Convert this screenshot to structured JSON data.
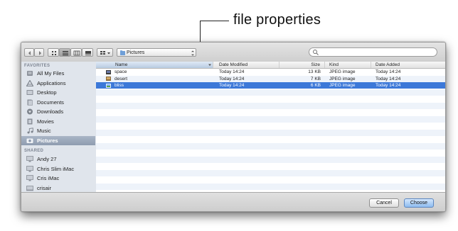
{
  "annotation": {
    "label": "file properties"
  },
  "toolbar": {
    "location": "Pictures",
    "search_placeholder": ""
  },
  "sidebar": {
    "favorites_heading": "FAVORITES",
    "favorites": [
      {
        "label": "All My Files",
        "icon": "all-files-icon"
      },
      {
        "label": "Applications",
        "icon": "applications-icon"
      },
      {
        "label": "Desktop",
        "icon": "desktop-icon"
      },
      {
        "label": "Documents",
        "icon": "documents-icon"
      },
      {
        "label": "Downloads",
        "icon": "downloads-icon"
      },
      {
        "label": "Movies",
        "icon": "movies-icon"
      },
      {
        "label": "Music",
        "icon": "music-icon"
      },
      {
        "label": "Pictures",
        "icon": "pictures-icon",
        "selected": true
      }
    ],
    "shared_heading": "SHARED",
    "shared": [
      {
        "label": "Andy 27",
        "icon": "computer-icon"
      },
      {
        "label": "Chris Slim iMac",
        "icon": "computer-icon"
      },
      {
        "label": "Cris iMac",
        "icon": "computer-icon"
      },
      {
        "label": "crisair",
        "icon": "computer-icon"
      }
    ]
  },
  "file_list": {
    "columns": [
      "Name",
      "Date Modified",
      "Size",
      "Kind",
      "Date Added"
    ],
    "rows": [
      {
        "name": "space",
        "modified": "Today 14:24",
        "size": "13 KB",
        "kind": "JPEG image",
        "added": "Today 14:24"
      },
      {
        "name": "desert",
        "modified": "Today 14:24",
        "size": "7 KB",
        "kind": "JPEG image",
        "added": "Today 14:24"
      },
      {
        "name": "bliss",
        "modified": "Today 14:24",
        "size": "6 KB",
        "kind": "JPEG image",
        "added": "Today 14:24",
        "selected": true
      }
    ]
  },
  "buttons": {
    "cancel": "Cancel",
    "choose": "Choose"
  },
  "colors": {
    "selection": "#3c78d8",
    "sidebar_bg": "#e0e5ec",
    "alt_row": "#eef3fa"
  }
}
